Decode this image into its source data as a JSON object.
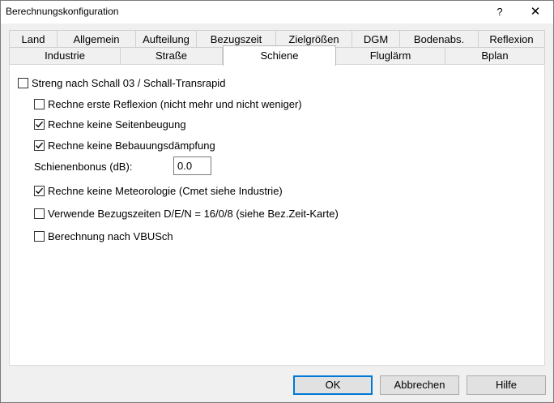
{
  "window": {
    "title": "Berechnungskonfiguration",
    "help_label": "?",
    "close_label": "✕"
  },
  "tabs_row1": [
    "Land",
    "Allgemein",
    "Aufteilung",
    "Bezugszeit",
    "Zielgrößen",
    "DGM",
    "Bodenabs.",
    "Reflexion"
  ],
  "tabs_row2": [
    "Industrie",
    "Straße",
    "Schiene",
    "Fluglärm",
    "Bplan"
  ],
  "active_tab": "Schiene",
  "options": {
    "streng": {
      "label": "Streng nach Schall 03 / Schall-Transrapid",
      "checked": false
    },
    "erste_reflexion": {
      "label": "Rechne erste Reflexion (nicht mehr und nicht weniger)",
      "checked": false
    },
    "keine_seitenbeugung": {
      "label": "Rechne keine Seitenbeugung",
      "checked": true
    },
    "keine_bebauungsdaempfung": {
      "label": "Rechne keine Bebauungsdämpfung",
      "checked": true
    },
    "schienenbonus": {
      "label": "Schienenbonus (dB):",
      "value": "0.0"
    },
    "keine_meteorologie": {
      "label": "Rechne keine Meteorologie (Cmet siehe Industrie)",
      "checked": true
    },
    "bezugszeiten": {
      "label": "Verwende Bezugszeiten D/E/N = 16/0/8 (siehe Bez.Zeit-Karte)",
      "checked": false
    },
    "vbusch": {
      "label": "Berechnung nach VBUSch",
      "checked": false
    }
  },
  "buttons": {
    "ok": "OK",
    "cancel": "Abbrechen",
    "help": "Hilfe"
  }
}
